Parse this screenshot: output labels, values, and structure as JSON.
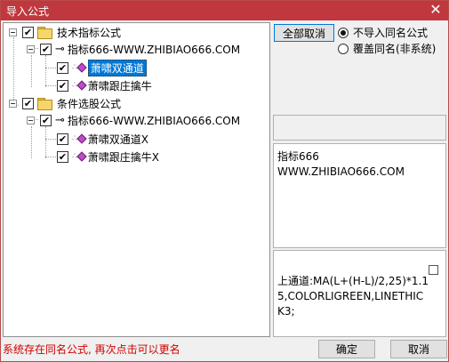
{
  "window": {
    "title": "导入公式",
    "close_glyph": "✕"
  },
  "tree": {
    "groups": [
      {
        "label": "技术指标公式",
        "checked": "✔",
        "pack": "指标666-WWW.ZHIBIAO666.COM",
        "items": [
          {
            "label": "萧啸双通道",
            "selected": true
          },
          {
            "label": "萧啸跟庄擒牛",
            "selected": false
          }
        ]
      },
      {
        "label": "条件选股公式",
        "checked": "✔",
        "pack": "指标666-WWW.ZHIBIAO666.COM",
        "items": [
          {
            "label": "萧啸双通道X",
            "selected": false
          },
          {
            "label": "萧啸跟庄擒牛X",
            "selected": false
          }
        ]
      }
    ]
  },
  "options": {
    "cancel_all_label": "全部取消",
    "radio_skip_label": "不导入同名公式",
    "radio_overwrite_label": "覆盖同名(非系统)",
    "selected": "skip"
  },
  "info": {
    "line1": "指标666",
    "line2": "WWW.ZHIBIAO666.COM"
  },
  "formula": {
    "text": "上通道:MA(L+(H-L)/2,25)*1.15,COLORLIGREEN,LINETHICK3;"
  },
  "status": {
    "message": "系统存在同名公式, 再次点击可以更名"
  },
  "footer": {
    "ok_label": "确定",
    "cancel_label": "取消"
  },
  "colors": {
    "titlebar": "#c0383e",
    "selection": "#0078d7",
    "status": "#d00000"
  }
}
